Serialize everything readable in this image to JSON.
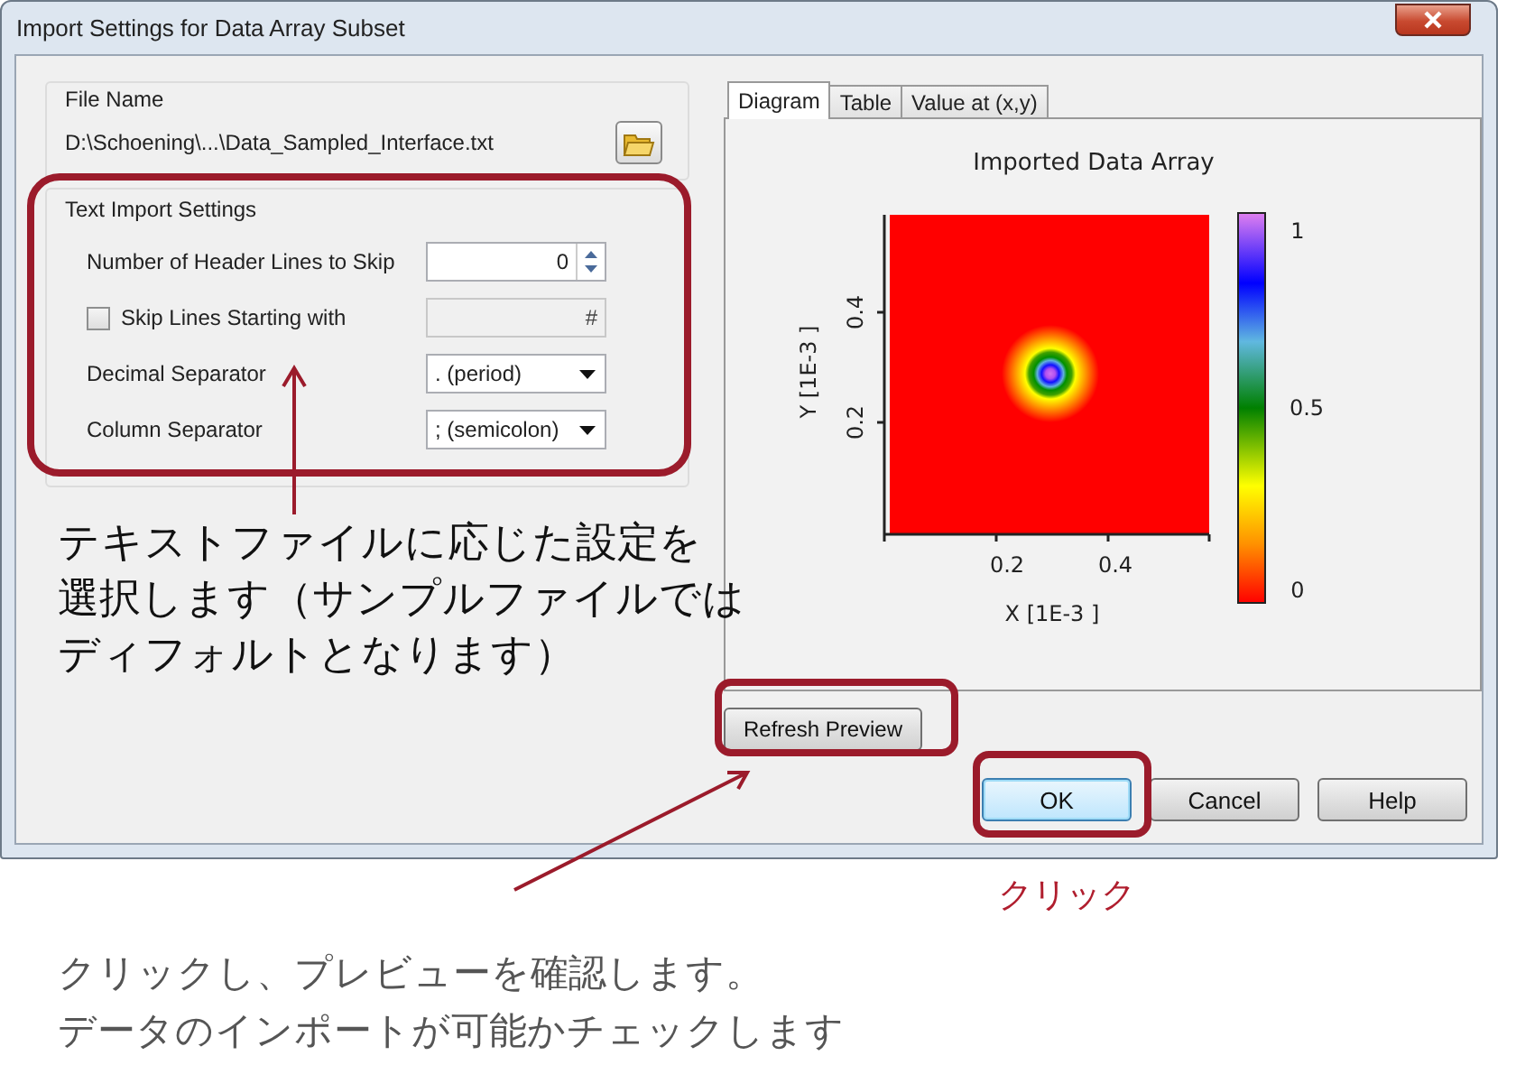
{
  "window": {
    "title": "Import Settings for Data Array Subset"
  },
  "file_name": {
    "label": "File Name",
    "path": "D:\\Schoening\\...\\Data_Sampled_Interface.txt"
  },
  "text_import": {
    "label": "Text Import Settings",
    "fields": [
      {
        "kind": "spinner",
        "label": "Number of Header Lines to Skip",
        "value": "0"
      },
      {
        "kind": "checkbox",
        "label": "Skip Lines Starting with",
        "checked": false,
        "value": "#",
        "disabled": true
      },
      {
        "kind": "dropdown",
        "label": "Decimal Separator",
        "value": ". (period)"
      },
      {
        "kind": "dropdown",
        "label": "Column Separator",
        "value": "; (semicolon)"
      }
    ]
  },
  "tabs": [
    {
      "label": "Diagram",
      "selected": true
    },
    {
      "label": "Table",
      "selected": false
    },
    {
      "label": "Value at (x,y)",
      "selected": false
    }
  ],
  "diagram": {
    "title": "Imported Data Array",
    "xlabel": "X [1E-3 ]",
    "ylabel": "Y [1E-3 ]",
    "xticks": [
      "0.2",
      "0.4"
    ],
    "yticks": [
      "0.2",
      "0.4"
    ],
    "colorbar_ticks": [
      "1",
      "0.5",
      "0"
    ]
  },
  "refresh_button": "Refresh Preview",
  "buttons": [
    {
      "label": "OK",
      "default": true
    },
    {
      "label": "Cancel",
      "default": false
    },
    {
      "label": "Help",
      "default": false
    }
  ],
  "settings_note": {
    "lines": [
      "テキストファイルに応じた設定を",
      "選択します（サンプルファイルでは",
      "ディフォルトとなります）"
    ]
  },
  "ok_note": "クリック",
  "refresh_note": {
    "lines": [
      "クリックし、プレビューを確認します。",
      "データのインポートが可能かチェックします"
    ]
  }
}
